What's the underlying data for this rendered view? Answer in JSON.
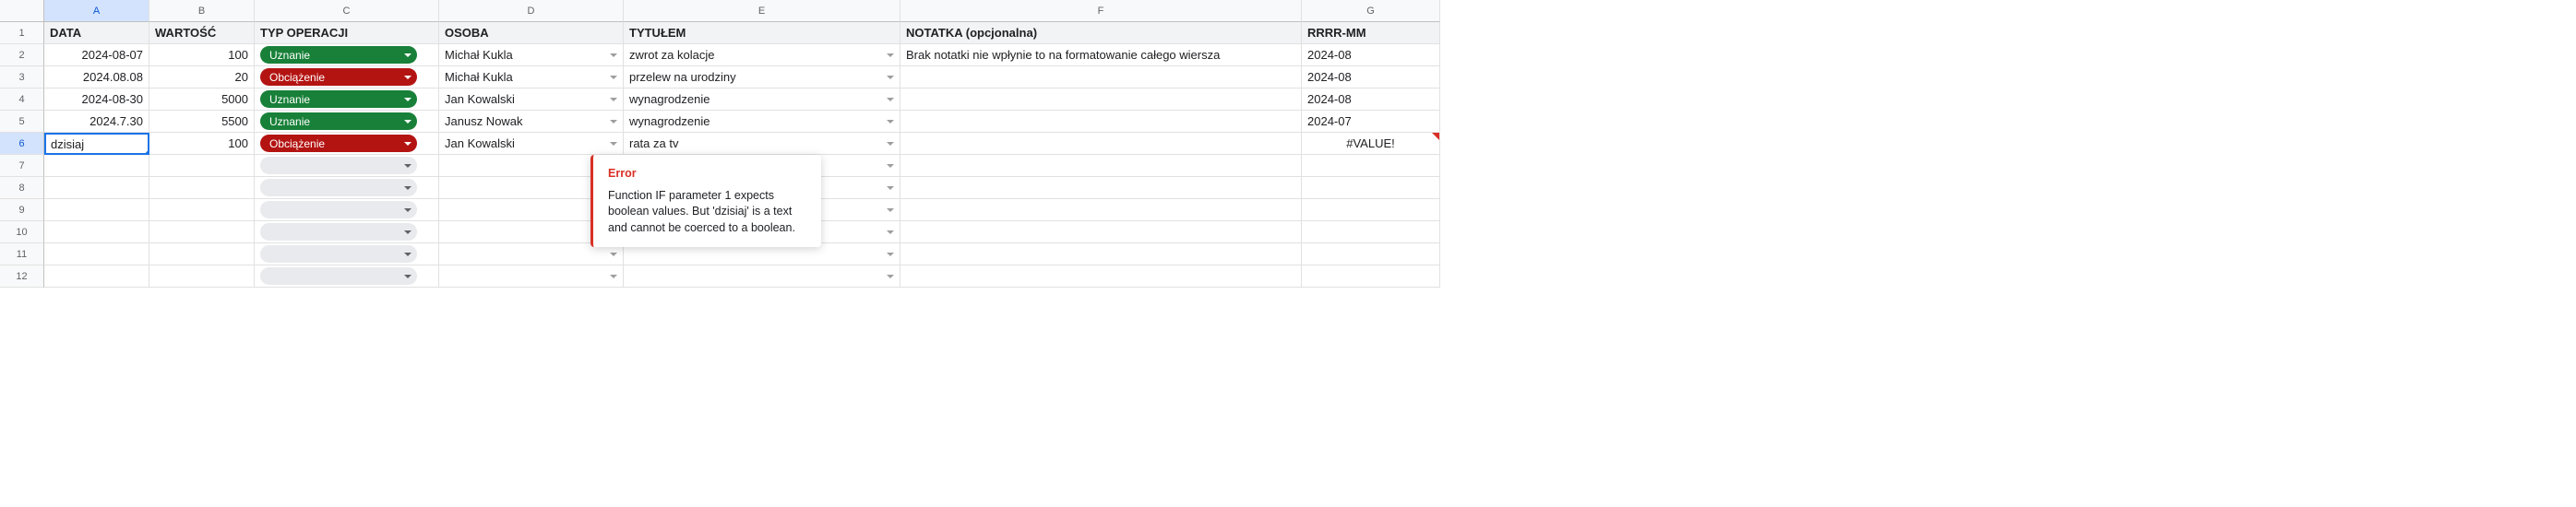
{
  "columns": [
    "A",
    "B",
    "C",
    "D",
    "E",
    "F",
    "G"
  ],
  "row_numbers": [
    1,
    2,
    3,
    4,
    5,
    6,
    7,
    8,
    9,
    10,
    11,
    12
  ],
  "active_cell": {
    "row": 6,
    "col": "A"
  },
  "headers": {
    "A": "DATA",
    "B": "WARTOŚĆ",
    "C": "TYP OPERACJI",
    "D": "OSOBA",
    "E": "TYTUŁEM",
    "F": "NOTATKA (opcjonalna)",
    "G": "RRRR-MM"
  },
  "rows": [
    {
      "A": "2024-08-07",
      "B": "100",
      "C": {
        "label": "Uznanie",
        "color": "green"
      },
      "D": "Michał Kukla",
      "E": "zwrot za kolacje",
      "F": "Brak notatki nie wpłynie to na formatowanie całego wiersza",
      "G": "2024-08"
    },
    {
      "A": "2024.08.08",
      "B": "20",
      "C": {
        "label": "Obciążenie",
        "color": "red"
      },
      "D": "Michał Kukla",
      "E": "przelew na urodziny",
      "F": "",
      "G": "2024-08"
    },
    {
      "A": "2024-08-30",
      "B": "5000",
      "C": {
        "label": "Uznanie",
        "color": "green"
      },
      "D": "Jan Kowalski",
      "E": "wynagrodzenie",
      "F": "",
      "G": "2024-08"
    },
    {
      "A": "2024.7.30",
      "B": "5500",
      "C": {
        "label": "Uznanie",
        "color": "green"
      },
      "D": "Janusz Nowak",
      "E": "wynagrodzenie",
      "F": "",
      "G": "2024-07"
    },
    {
      "A": "dzisiaj",
      "B": "100",
      "C": {
        "label": "Obciążenie",
        "color": "red"
      },
      "D": "Jan Kowalski",
      "E": "rata za tv",
      "F": "",
      "G": "#VALUE!"
    }
  ],
  "error_tooltip": {
    "title": "Error",
    "body": "Function IF parameter 1 expects boolean values. But 'dzisiaj' is a text and cannot be coerced to a boolean."
  },
  "chart_data": {
    "type": "table",
    "columns": [
      "DATA",
      "WARTOŚĆ",
      "TYP OPERACJI",
      "OSOBA",
      "TYTUŁEM",
      "NOTATKA (opcjonalna)",
      "RRRR-MM"
    ],
    "rows": [
      [
        "2024-08-07",
        100,
        "Uznanie",
        "Michał Kukla",
        "zwrot za kolacje",
        "Brak notatki nie wpłynie to na formatowanie całego wiersza",
        "2024-08"
      ],
      [
        "2024.08.08",
        20,
        "Obciążenie",
        "Michał Kukla",
        "przelew na urodziny",
        "",
        "2024-08"
      ],
      [
        "2024-08-30",
        5000,
        "Uznanie",
        "Jan Kowalski",
        "wynagrodzenie",
        "",
        "2024-08"
      ],
      [
        "2024.7.30",
        5500,
        "Uznanie",
        "Janusz Nowak",
        "wynagrodzenie",
        "",
        "2024-07"
      ],
      [
        "dzisiaj",
        100,
        "Obciążenie",
        "Jan Kowalski",
        "rata za tv",
        "",
        "#VALUE!"
      ]
    ]
  }
}
